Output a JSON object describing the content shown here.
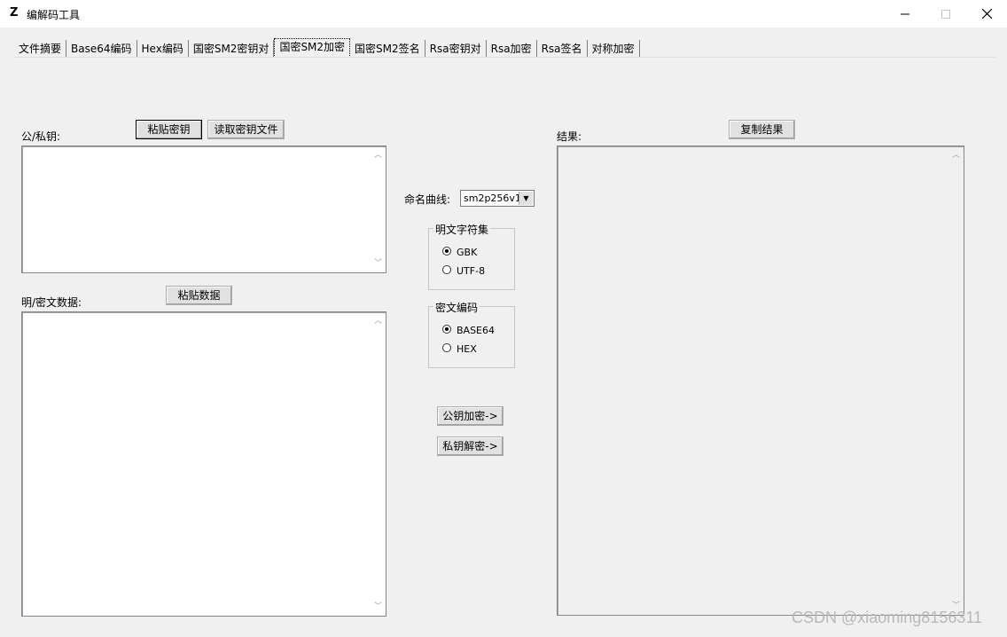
{
  "window": {
    "title": "编解码工具",
    "app_icon": "Z",
    "minimize_glyph": "—",
    "maximize_glyph": "☐",
    "close_glyph": "✕"
  },
  "tabs": [
    {
      "label": "文件摘要"
    },
    {
      "label": "Base64编码"
    },
    {
      "label": "Hex编码"
    },
    {
      "label": "国密SM2密钥对"
    },
    {
      "label": "国密SM2加密",
      "active": true
    },
    {
      "label": "国密SM2签名"
    },
    {
      "label": "Rsa密钥对"
    },
    {
      "label": "Rsa加密"
    },
    {
      "label": "Rsa签名"
    },
    {
      "label": "对称加密"
    }
  ],
  "key_section": {
    "label": "公/私钥:",
    "paste_button": "粘贴密钥",
    "read_file_button": "读取密钥文件",
    "value": ""
  },
  "data_section": {
    "label": "明/密文数据:",
    "paste_button": "粘贴数据",
    "value": ""
  },
  "curve": {
    "label": "命名曲线:",
    "selected": "sm2p256v1"
  },
  "charset_group": {
    "title": "明文字符集",
    "options": [
      {
        "label": "GBK",
        "checked": true
      },
      {
        "label": "UTF-8",
        "checked": false
      }
    ]
  },
  "encoding_group": {
    "title": "密文编码",
    "options": [
      {
        "label": "BASE64",
        "checked": true
      },
      {
        "label": "HEX",
        "checked": false
      }
    ]
  },
  "actions": {
    "encrypt_button": "公钥加密->",
    "decrypt_button": "私钥解密->"
  },
  "result_section": {
    "label": "结果:",
    "copy_button": "复制结果",
    "value": ""
  },
  "watermark": "CSDN @xiaoming8156311"
}
